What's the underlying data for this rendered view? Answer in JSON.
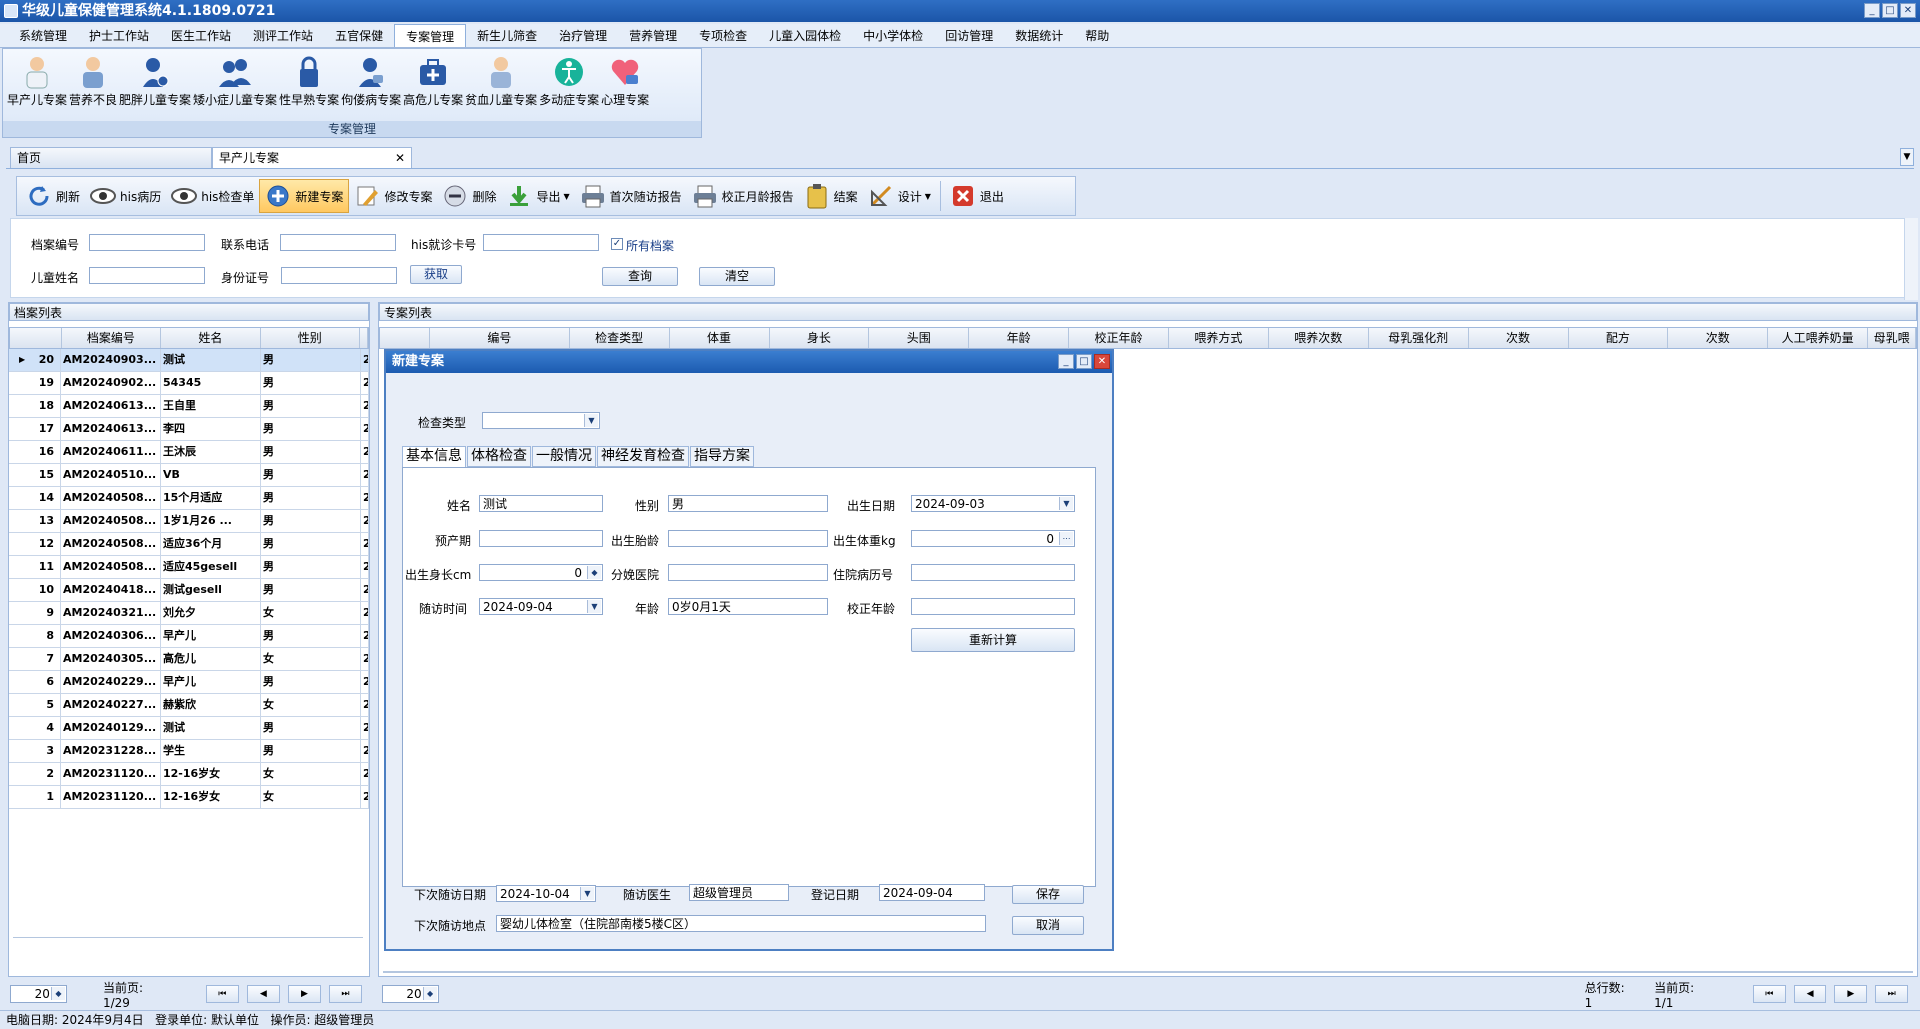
{
  "app": {
    "title": "华级儿童保健管理系统4.1.1809.0721"
  },
  "menu": [
    "系统管理",
    "护士工作站",
    "医生工作站",
    "测评工作站",
    "五官保健",
    "专案管理",
    "新生儿筛查",
    "治疗管理",
    "营养管理",
    "专项检查",
    "儿童入园体检",
    "中小学体检",
    "回访管理",
    "数据统计",
    "帮助"
  ],
  "ribbon": {
    "items": [
      "早产儿专案",
      "营养不良",
      "肥胖儿童专案",
      "矮小症儿童专案",
      "性早熟专案",
      "佝偻病专案",
      "高危儿专案",
      "贫血儿童专案",
      "多动症专案",
      "心理专案"
    ],
    "group": "专案管理"
  },
  "tabs": {
    "home": "首页",
    "active": "早产儿专案"
  },
  "toolbar": {
    "refresh": "刷新",
    "his_record": "his病历",
    "his_check": "his检查单",
    "new_case": "新建专案",
    "edit_case": "修改专案",
    "delete": "删除",
    "export": "导出",
    "first_report": "首次随访报告",
    "corrected_report": "校正月龄报告",
    "close_case": "结案",
    "design": "设计",
    "exit": "退出"
  },
  "search": {
    "file_no": "档案编号",
    "phone": "联系电话",
    "his_card": "his就诊卡号",
    "all_files": "所有档案",
    "child_name": "儿童姓名",
    "id_no": "身份证号",
    "fetch": "获取",
    "query": "查询",
    "clear": "清空"
  },
  "left": {
    "title": "档案列表",
    "headers": [
      "档案编号",
      "姓名",
      "性别"
    ],
    "rows": [
      {
        "n": "20",
        "id": "AM20240903...",
        "name": "测试",
        "sex": "男",
        "e": "2"
      },
      {
        "n": "19",
        "id": "AM20240902...",
        "name": "54345",
        "sex": "男",
        "e": "2"
      },
      {
        "n": "18",
        "id": "AM20240613...",
        "name": "王自里",
        "sex": "男",
        "e": "2"
      },
      {
        "n": "17",
        "id": "AM20240613...",
        "name": "李四",
        "sex": "男",
        "e": "2"
      },
      {
        "n": "16",
        "id": "AM20240611...",
        "name": "王沐辰",
        "sex": "男",
        "e": "2"
      },
      {
        "n": "15",
        "id": "AM20240510...",
        "name": "VB",
        "sex": "男",
        "e": "2"
      },
      {
        "n": "14",
        "id": "AM20240508...",
        "name": "15个月适应",
        "sex": "男",
        "e": "2"
      },
      {
        "n": "13",
        "id": "AM20240508...",
        "name": "1岁1月26 ...",
        "sex": "男",
        "e": "2"
      },
      {
        "n": "12",
        "id": "AM20240508...",
        "name": "适应36个月",
        "sex": "男",
        "e": "2"
      },
      {
        "n": "11",
        "id": "AM20240508...",
        "name": "适应45gesell",
        "sex": "男",
        "e": "2"
      },
      {
        "n": "10",
        "id": "AM20240418...",
        "name": "测试gesell",
        "sex": "男",
        "e": "2"
      },
      {
        "n": "9",
        "id": "AM20240321...",
        "name": "刘允夕",
        "sex": "女",
        "e": "2"
      },
      {
        "n": "8",
        "id": "AM20240306...",
        "name": "早产儿",
        "sex": "男",
        "e": "2"
      },
      {
        "n": "7",
        "id": "AM20240305...",
        "name": "高危儿",
        "sex": "女",
        "e": "2"
      },
      {
        "n": "6",
        "id": "AM20240229...",
        "name": "早产儿",
        "sex": "男",
        "e": "2"
      },
      {
        "n": "5",
        "id": "AM20240227...",
        "name": "赫紫欣",
        "sex": "女",
        "e": "2"
      },
      {
        "n": "4",
        "id": "AM20240129...",
        "name": "测试",
        "sex": "男",
        "e": "2"
      },
      {
        "n": "3",
        "id": "AM20231228...",
        "name": "学生",
        "sex": "男",
        "e": "2"
      },
      {
        "n": "2",
        "id": "AM20231120...",
        "name": "12-16岁女",
        "sex": "女",
        "e": "2"
      },
      {
        "n": "1",
        "id": "AM20231120...",
        "name": "12-16岁女",
        "sex": "女",
        "e": "2"
      }
    ],
    "page_size": "20",
    "current_page": "当前页: 1/29"
  },
  "right": {
    "title": "专案列表",
    "headers": [
      "编号",
      "检查类型",
      "体重",
      "身长",
      "头围",
      "年龄",
      "校正年龄",
      "喂养方式",
      "喂养次数",
      "母乳强化剂",
      "次数",
      "配方",
      "次数",
      "人工喂养奶量",
      "母乳喂"
    ],
    "page_size": "20",
    "total": "总行数: 1",
    "current_page": "当前页: 1/1"
  },
  "dialog": {
    "title": "新建专案",
    "check_type": "检查类型",
    "tabs": [
      "基本信息",
      "体格检查",
      "一般情况",
      "神经发育检查",
      "指导方案"
    ],
    "fields": {
      "name_l": "姓名",
      "name_v": "测试",
      "sex_l": "性别",
      "sex_v": "男",
      "birth_l": "出生日期",
      "birth_v": "2024-09-03",
      "due_l": "预产期",
      "ga_l": "出生胎龄",
      "bw_l": "出生体重kg",
      "bw_v": "0",
      "bl_l": "出生身长cm",
      "bl_v": "0",
      "hosp_l": "分娩医院",
      "inpat_l": "住院病历号",
      "visit_l": "随访时间",
      "visit_v": "2024-09-04",
      "age_l": "年龄",
      "age_v": "0岁0月1天",
      "cage_l": "校正年龄",
      "recalc": "重新计算"
    },
    "bottom": {
      "next_date_l": "下次随访日期",
      "next_date_v": "2024-10-04",
      "doctor_l": "随访医生",
      "doctor_v": "超级管理员",
      "reg_l": "登记日期",
      "reg_v": "2024-09-04",
      "place_l": "下次随访地点",
      "place_v": "婴幼儿体检室（住院部南楼5楼C区）",
      "save": "保存",
      "cancel": "取消"
    }
  },
  "status": {
    "date": "电脑日期: 2024年9月4日",
    "unit": "登录单位: 默认单位",
    "operator": "操作员: 超级管理员"
  }
}
